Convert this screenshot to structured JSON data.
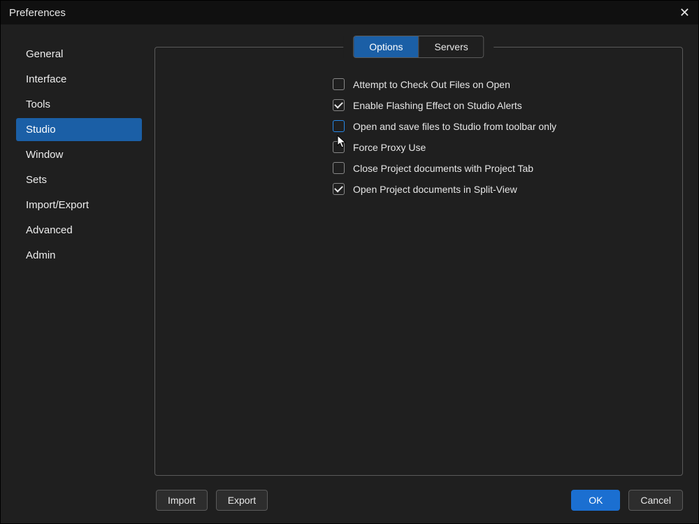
{
  "window": {
    "title": "Preferences"
  },
  "sidebar": {
    "items": [
      {
        "key": "general",
        "label": "General",
        "selected": false
      },
      {
        "key": "interface",
        "label": "Interface",
        "selected": false
      },
      {
        "key": "tools",
        "label": "Tools",
        "selected": false
      },
      {
        "key": "studio",
        "label": "Studio",
        "selected": true
      },
      {
        "key": "window",
        "label": "Window",
        "selected": false
      },
      {
        "key": "sets",
        "label": "Sets",
        "selected": false
      },
      {
        "key": "import-export",
        "label": "Import/Export",
        "selected": false
      },
      {
        "key": "advanced",
        "label": "Advanced",
        "selected": false
      },
      {
        "key": "admin",
        "label": "Admin",
        "selected": false
      }
    ]
  },
  "tabs": {
    "items": [
      {
        "key": "options",
        "label": "Options",
        "active": true
      },
      {
        "key": "servers",
        "label": "Servers",
        "active": false
      }
    ]
  },
  "options": [
    {
      "key": "checkout-on-open",
      "label": "Attempt to Check Out Files on Open",
      "checked": false,
      "highlight": false
    },
    {
      "key": "flashing-alerts",
      "label": "Enable Flashing Effect on Studio Alerts",
      "checked": true,
      "highlight": false
    },
    {
      "key": "toolbar-only",
      "label": "Open and save files to Studio from toolbar only",
      "checked": false,
      "highlight": true
    },
    {
      "key": "force-proxy",
      "label": "Force Proxy Use",
      "checked": false,
      "highlight": false
    },
    {
      "key": "close-with-tab",
      "label": "Close Project documents with Project Tab",
      "checked": false,
      "highlight": false
    },
    {
      "key": "split-view",
      "label": "Open Project documents in Split-View",
      "checked": true,
      "highlight": false
    }
  ],
  "footer": {
    "import_label": "Import",
    "export_label": "Export",
    "ok_label": "OK",
    "cancel_label": "Cancel"
  }
}
